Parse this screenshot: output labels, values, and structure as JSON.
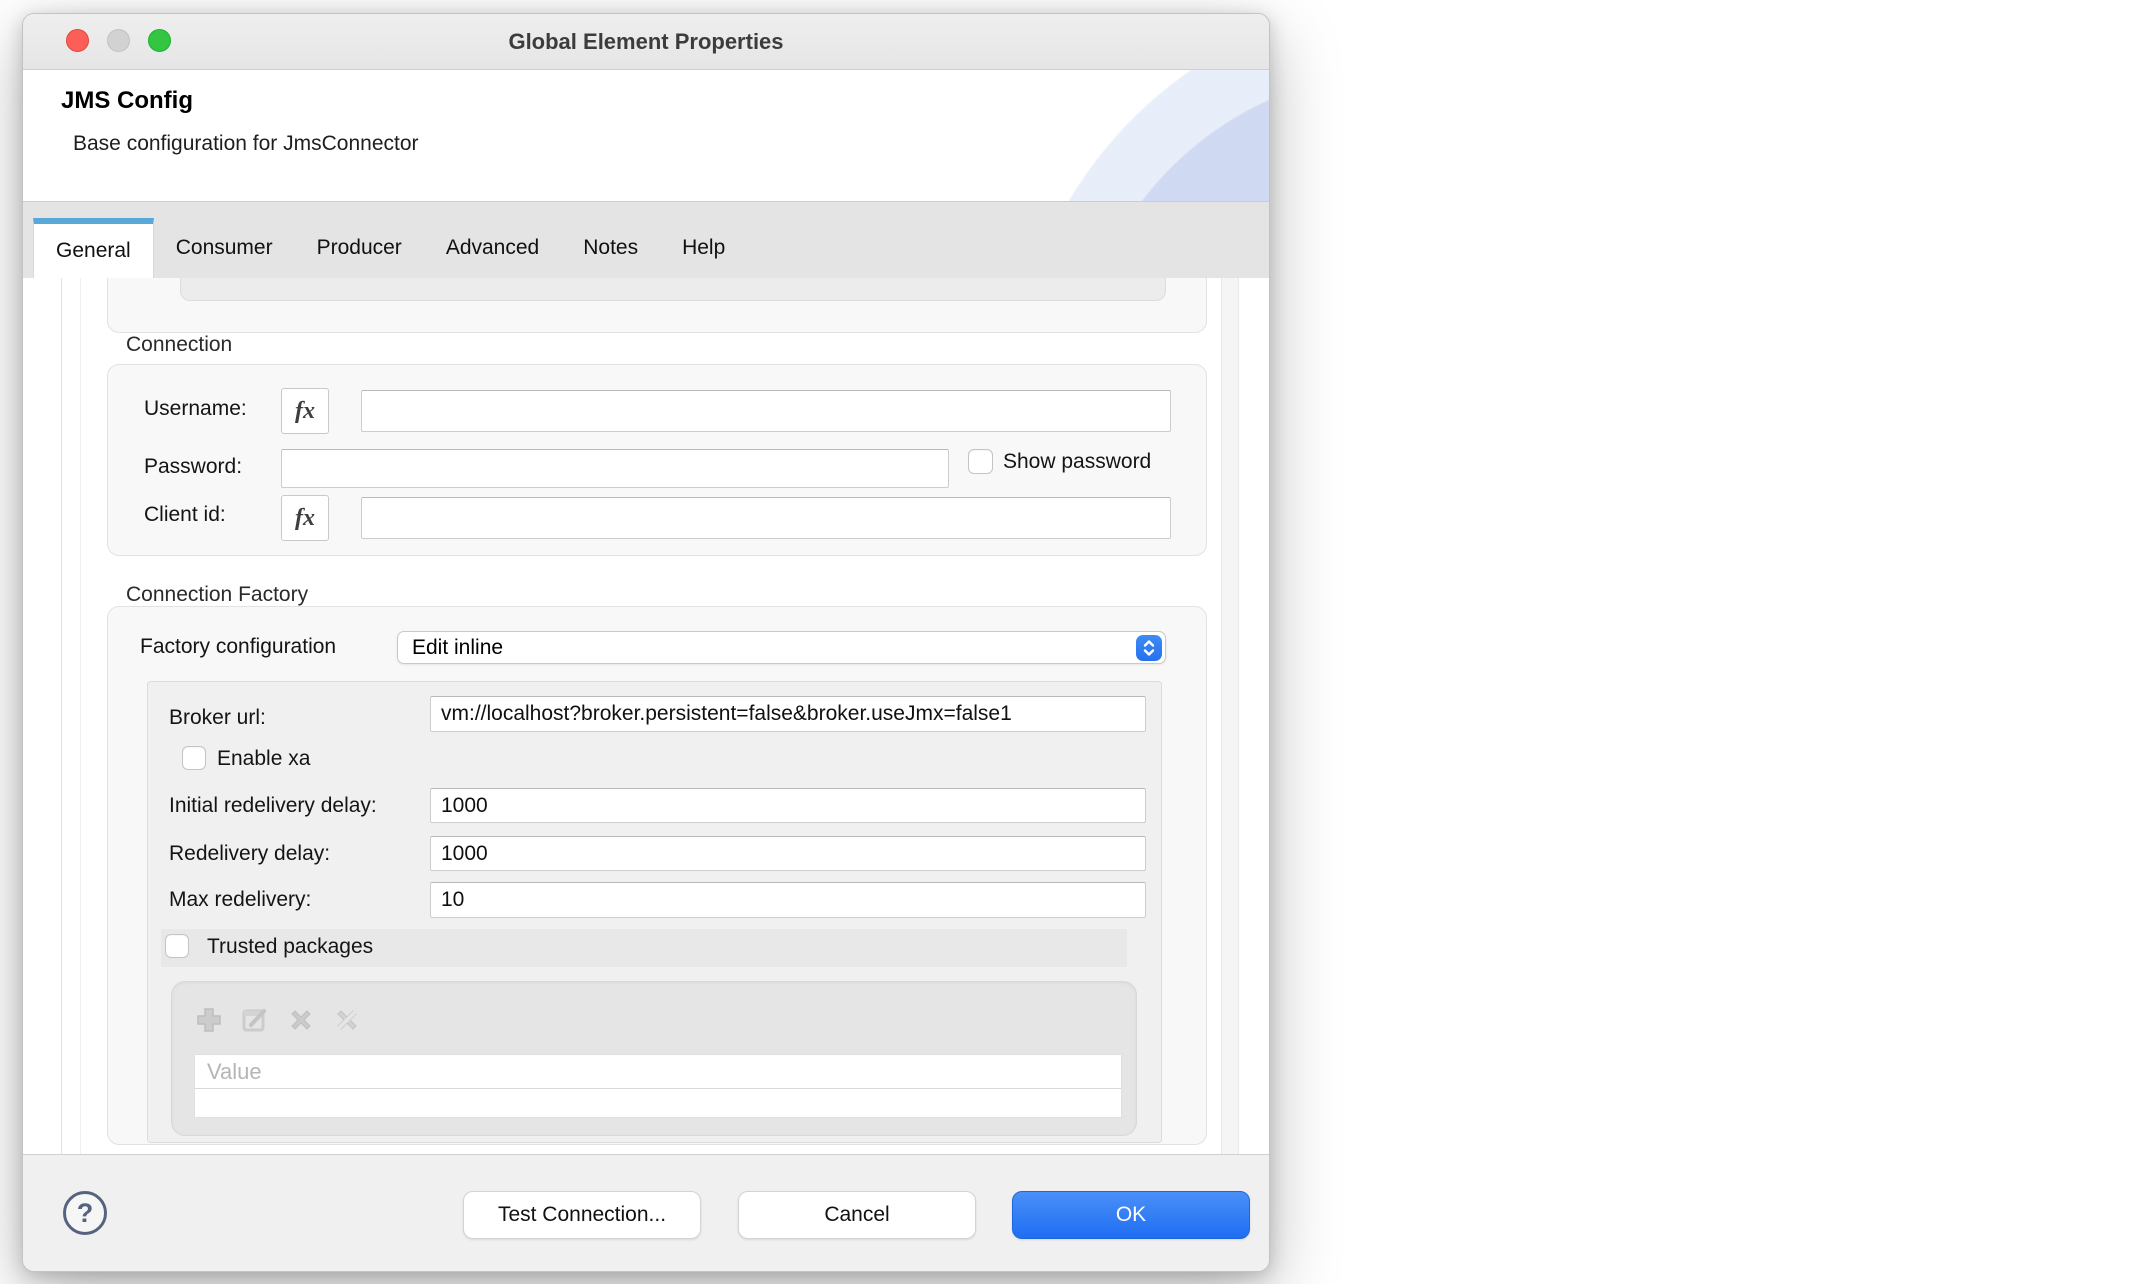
{
  "window": {
    "title": "Global Element Properties",
    "traffic_lights": [
      "close",
      "minimize",
      "zoom"
    ]
  },
  "header": {
    "title": "JMS Config",
    "subtitle": "Base configuration for JmsConnector"
  },
  "tabs": [
    {
      "label": "General",
      "active": true
    },
    {
      "label": "Consumer",
      "active": false
    },
    {
      "label": "Producer",
      "active": false
    },
    {
      "label": "Advanced",
      "active": false
    },
    {
      "label": "Notes",
      "active": false
    },
    {
      "label": "Help",
      "active": false
    }
  ],
  "connection": {
    "section_label": "Connection",
    "username_label": "Username:",
    "username_value": "",
    "password_label": "Password:",
    "password_value": "",
    "show_password_label": "Show password",
    "show_password_checked": false,
    "client_id_label": "Client id:",
    "client_id_value": "",
    "fx_glyph": "fx"
  },
  "connection_factory": {
    "section_label": "Connection Factory",
    "factory_configuration_label": "Factory configuration",
    "factory_configuration_value": "Edit inline",
    "broker_url_label": "Broker url:",
    "broker_url_value": "vm://localhost?broker.persistent=false&broker.useJmx=false1",
    "enable_xa_label": "Enable xa",
    "enable_xa_checked": false,
    "initial_redelivery_delay_label": "Initial redelivery delay:",
    "initial_redelivery_delay_value": "1000",
    "redelivery_delay_label": "Redelivery delay:",
    "redelivery_delay_value": "1000",
    "max_redelivery_label": "Max redelivery:",
    "max_redelivery_value": "10",
    "trusted_packages_label": "Trusted packages",
    "trusted_packages_checked": false,
    "trusted_table": {
      "column_header": "Value",
      "rows": [],
      "toolbar_icons": [
        "add-icon",
        "edit-icon",
        "delete-icon",
        "delete-all-icon"
      ]
    }
  },
  "footer": {
    "help_label": "?",
    "test_connection_label": "Test Connection...",
    "cancel_label": "Cancel",
    "ok_label": "OK"
  },
  "colors": {
    "accent_blue": "#2e7ef2",
    "tab_active_indicator": "#58a9d8",
    "ok_button": "#1f6ef2",
    "traffic_red": "#fb5f57",
    "traffic_gray": "#d2d2d2",
    "traffic_green": "#32c642",
    "disabled_icon_gray": "#c6c6c6"
  }
}
